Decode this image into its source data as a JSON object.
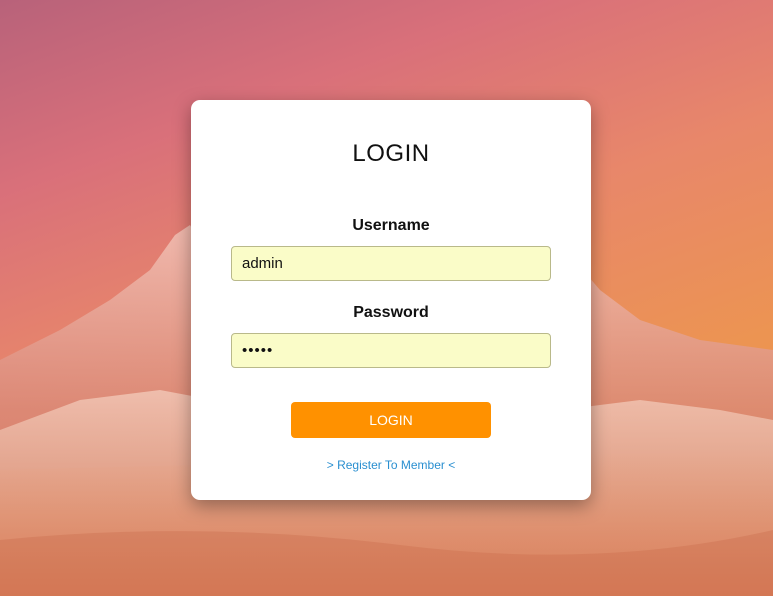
{
  "login": {
    "title": "LOGIN",
    "username_label": "Username",
    "username_value": "admin",
    "password_label": "Password",
    "password_value": "•••••",
    "submit_label": "LOGIN",
    "register_link": "> Register To Member <"
  },
  "colors": {
    "button": "#ff9100",
    "input_background": "#fafcc8",
    "link": "#2a8fd0"
  },
  "background_icon": "mountain-landscape"
}
